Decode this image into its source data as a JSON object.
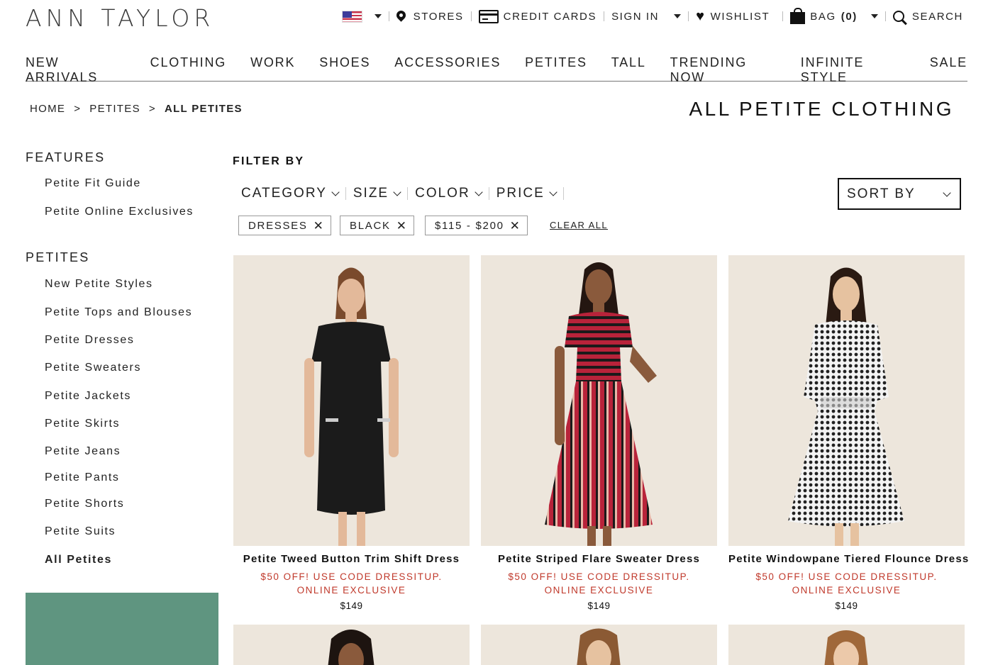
{
  "brand": {
    "logo": "ANN TAYLOR"
  },
  "utility": {
    "locale_icon": "us-flag-icon",
    "stores": "STORES",
    "credit_cards": "CREDIT CARDS",
    "sign_in": "SIGN IN",
    "wishlist": "WISHLIST",
    "bag_label": "BAG",
    "bag_count": "(0)",
    "search": "SEARCH"
  },
  "nav": {
    "items": [
      "NEW ARRIVALS",
      "CLOTHING",
      "WORK",
      "SHOES",
      "ACCESSORIES",
      "PETITES",
      "TALL",
      "TRENDING NOW",
      "INFINITE STYLE",
      "SALE"
    ]
  },
  "breadcrumb": {
    "items": [
      "HOME",
      "PETITES",
      "ALL PETITES"
    ],
    "separator": ">"
  },
  "page_title": "ALL PETITE CLOTHING",
  "sidebar": {
    "features_heading": "FEATURES",
    "features": [
      "Petite Fit Guide",
      "Petite Online Exclusives"
    ],
    "petites_heading": "PETITES",
    "petites": [
      "New Petite Styles",
      "Petite Tops and Blouses",
      "Petite Dresses",
      "Petite Sweaters",
      "Petite Jackets",
      "Petite Skirts",
      "Petite Jeans",
      "Petite Pants",
      "Petite Shorts",
      "Petite Suits",
      "All Petites"
    ],
    "active_item": "All Petites",
    "promo_color": "#5f9580"
  },
  "filters": {
    "heading": "FILTER BY",
    "dropdowns": [
      "CATEGORY",
      "SIZE",
      "COLOR",
      "PRICE"
    ],
    "sort_label": "SORT BY",
    "chips": [
      "DRESSES",
      "BLACK",
      "$115 - $200"
    ],
    "clear_all": "CLEAR ALL"
  },
  "products": [
    {
      "name": "Petite Tweed Button Trim Shift Dress",
      "promo": "$50 OFF! USE CODE DRESSITUP.",
      "badge": "ONLINE EXCLUSIVE",
      "price": "$149"
    },
    {
      "name": "Petite Striped Flare Sweater Dress",
      "promo": "$50 OFF! USE CODE DRESSITUP.",
      "badge": "ONLINE EXCLUSIVE",
      "price": "$149"
    },
    {
      "name": "Petite Windowpane Tiered Flounce Dress",
      "promo": "$50 OFF! USE CODE DRESSITUP.",
      "badge": "ONLINE EXCLUSIVE",
      "price": "$149"
    }
  ],
  "colors": {
    "promo_red": "#c0392b",
    "image_bg": "#ede6dc"
  }
}
